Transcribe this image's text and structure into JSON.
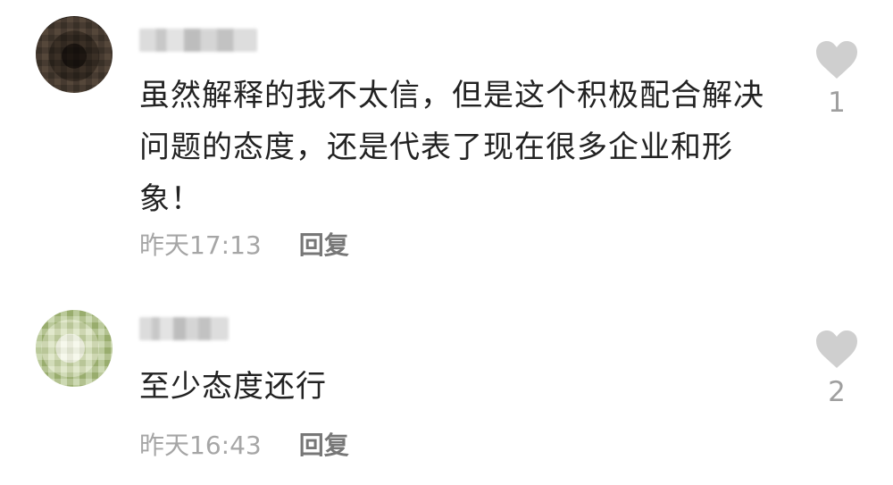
{
  "comments": [
    {
      "username": "",
      "text": "虽然解释的我不太信，但是这个积极配合解决问题的态度，还是代表了现在很多企业和形象！",
      "time": "昨天17:13",
      "reply": "回复",
      "likes": "1",
      "avatar_icon": "blurred-avatar-icon"
    },
    {
      "username": "",
      "text": "至少态度还行",
      "time": "昨天16:43",
      "reply": "回复",
      "likes": "2",
      "avatar_icon": "blurred-avatar-icon"
    }
  ],
  "colors": {
    "text": "#222222",
    "timestamp": "#a6a6a6",
    "reply": "#777777",
    "heart": "#cfcfcf",
    "like_count": "#9f9f9f",
    "background": "#ffffff"
  }
}
